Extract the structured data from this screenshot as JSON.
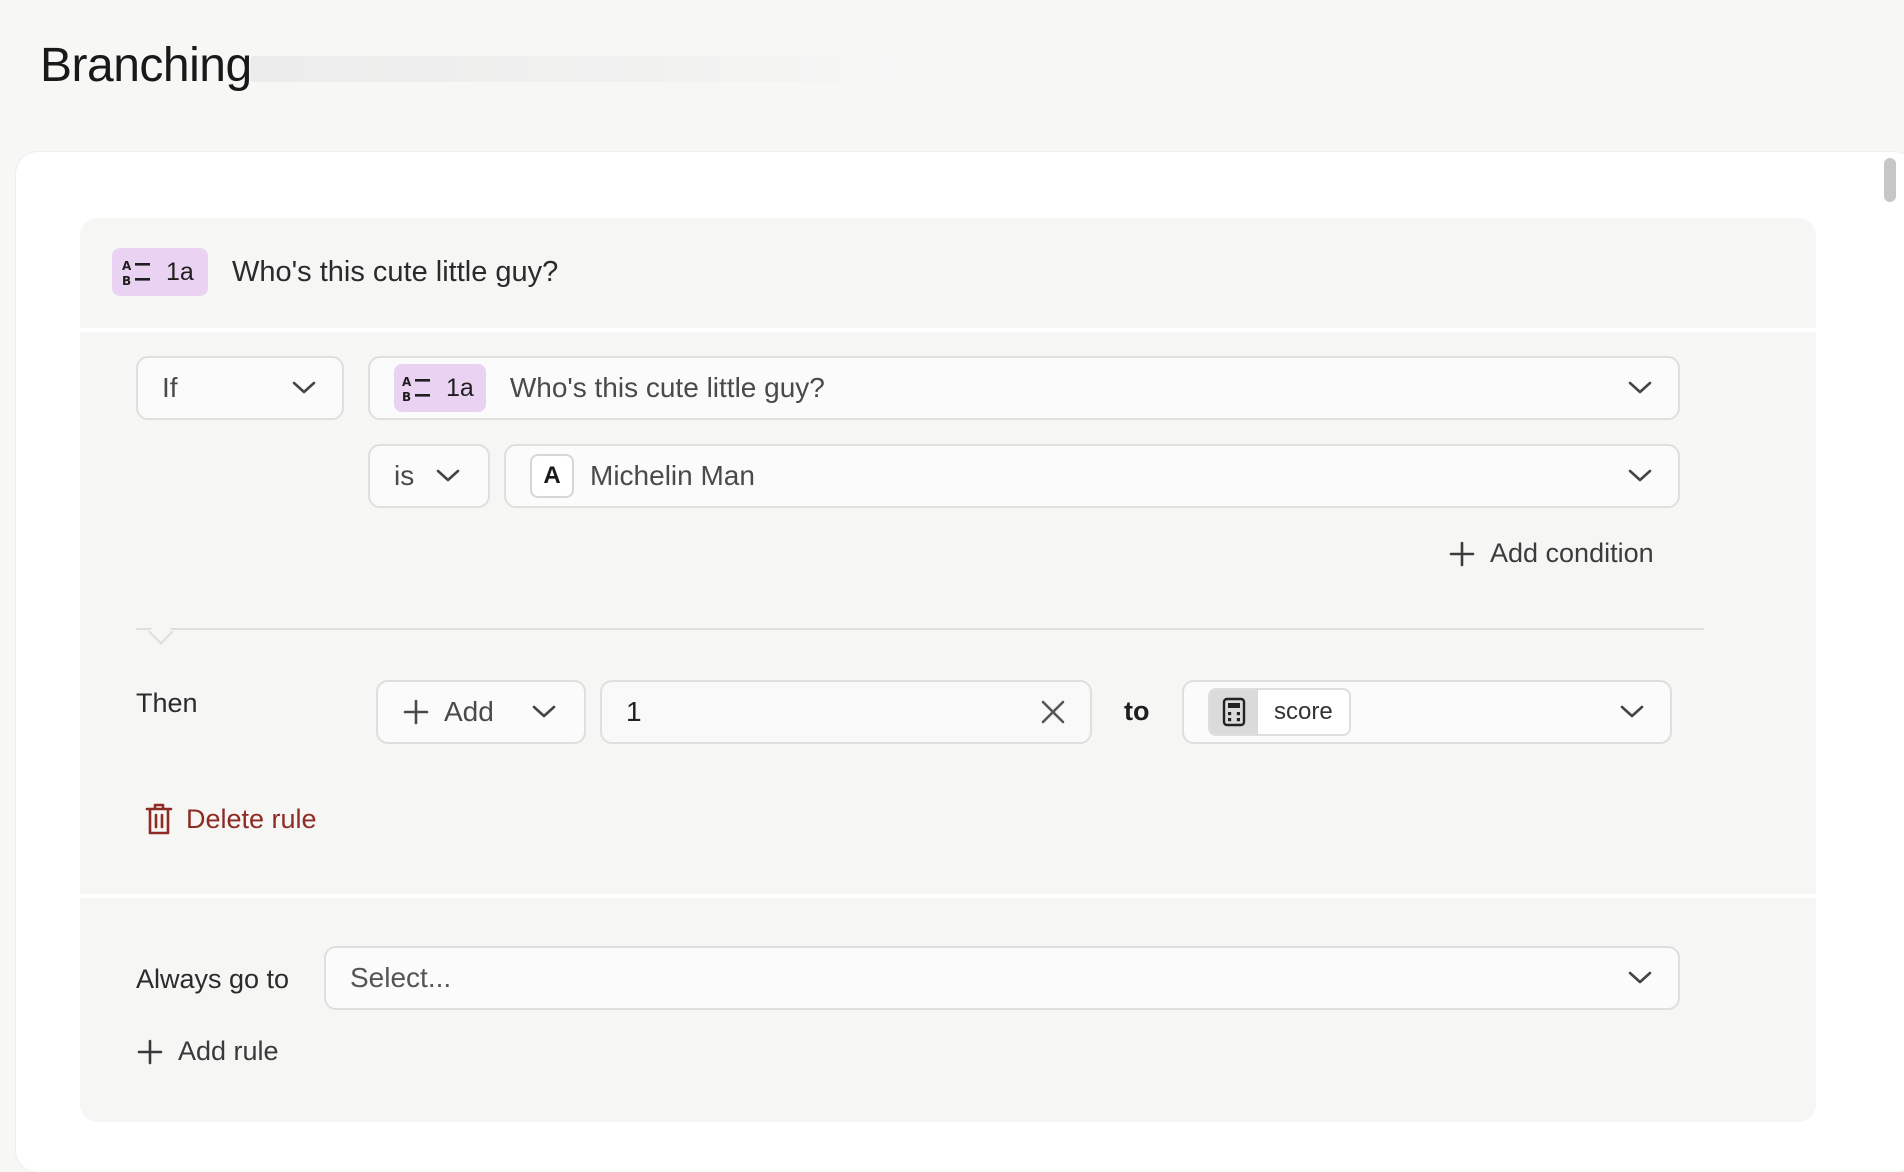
{
  "page": {
    "title": "Branching"
  },
  "question": {
    "number": "1a",
    "icon": "multiple-choice-icon",
    "title": "Who's this cute little guy?"
  },
  "rule": {
    "operator": "If",
    "condition_question_number": "1a",
    "condition_question_title": "Who's this cute little guy?",
    "comparator": "is",
    "answer_letter": "A",
    "answer_label": "Michelin Man",
    "add_condition_label": "Add condition",
    "then_label": "Then",
    "action_label": "Add",
    "action_value": "1",
    "to_label": "to",
    "variable_icon": "calculator-icon",
    "variable_name": "score",
    "delete_label": "Delete rule"
  },
  "fallback": {
    "label": "Always go to",
    "select_placeholder": "Select...",
    "add_rule_label": "Add rule"
  },
  "colors": {
    "badge_bg": "#ead3f2",
    "delete_red": "#8d2b24",
    "card_bg": "#f6f6f5"
  }
}
